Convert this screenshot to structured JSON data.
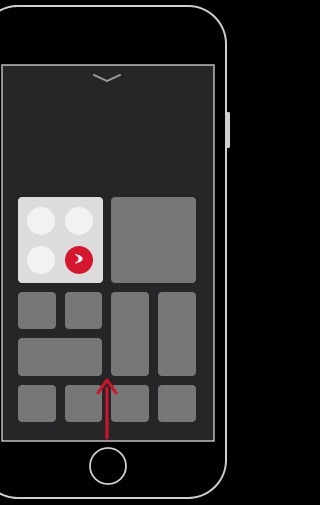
{
  "illustration": {
    "subject": "phone-control-center-swipe-up",
    "colors": {
      "background": "#000000",
      "phone_outline": "#cfcfcf",
      "screen_outline": "#bdbdbd",
      "screen_fill": "#262628",
      "tile_fill": "#777777",
      "connectivity_panel_fill": "#dcdcdc",
      "toggle_off_fill": "#f2f2f2",
      "bluetooth_active_fill": "#d6152f",
      "bluetooth_glyph": "#ffffff",
      "arrow": "#d1122c",
      "chevron": "#9a9a9a"
    },
    "icons": {
      "chevron": "chevron-down-icon",
      "bluetooth": "bluetooth-icon",
      "gesture": "swipe-up-arrow-icon",
      "home_button": "home-button"
    },
    "toggles": [
      {
        "name": "toggle-top-left",
        "state": "off"
      },
      {
        "name": "toggle-top-right",
        "state": "off"
      },
      {
        "name": "toggle-bottom-left",
        "state": "off"
      },
      {
        "name": "toggle-bottom-right-bluetooth",
        "state": "on"
      }
    ]
  }
}
